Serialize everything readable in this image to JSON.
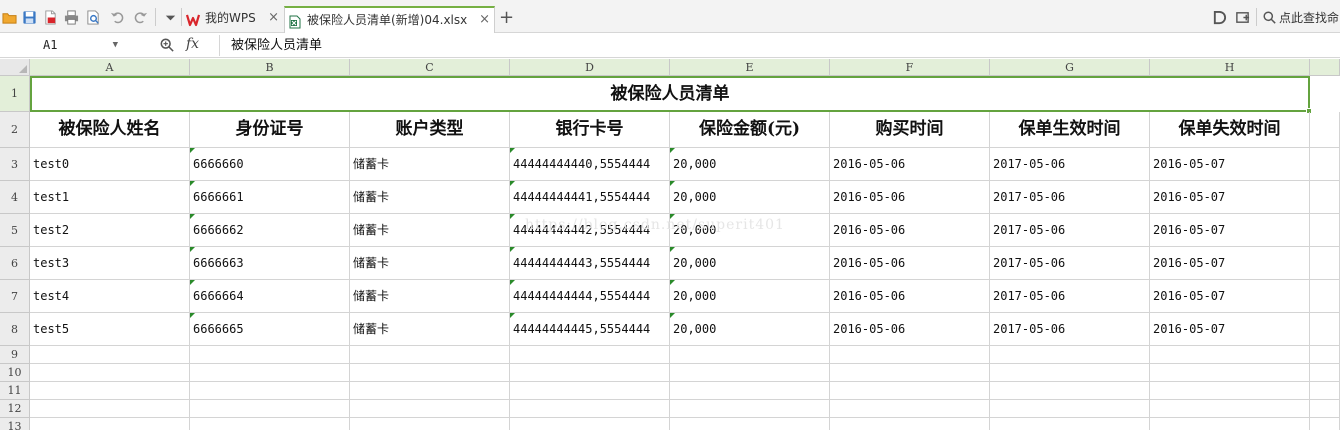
{
  "toolbar": {
    "quick_icons": [
      "open-folder-icon",
      "save-icon",
      "export-pdf-icon",
      "print-icon",
      "print-preview-icon",
      "undo-icon",
      "redo-icon",
      "dropdown-icon"
    ],
    "tabs": [
      {
        "label": "我的WPS",
        "icon": "wps-logo-icon",
        "close": "×"
      },
      {
        "label": "被保险人员清单(新增)04.xlsx",
        "icon": "excel-file-icon",
        "close": "×"
      }
    ],
    "add_tab": "+",
    "search_label": "点此查找命"
  },
  "formula_bar": {
    "name_box": "A1",
    "fx_label": "fx",
    "formula_value": "被保险人员清单"
  },
  "sheet": {
    "columns": [
      "A",
      "B",
      "C",
      "D",
      "E",
      "F",
      "G",
      "H"
    ],
    "rows": [
      "1",
      "2",
      "3",
      "4",
      "5",
      "6",
      "7",
      "8",
      "9",
      "10",
      "11",
      "12",
      "13"
    ],
    "title": "被保险人员清单",
    "headers": [
      "被保险人姓名",
      "身份证号",
      "账户类型",
      "银行卡号",
      "保险金额(元)",
      "购买时间",
      "保单生效时间",
      "保单失效时间"
    ],
    "data": [
      [
        "test0",
        "6666660",
        "储蓄卡",
        "44444444440,5554444",
        "20,000",
        "2016-05-06",
        "2017-05-06",
        "2016-05-07"
      ],
      [
        "test1",
        "6666661",
        "储蓄卡",
        "44444444441,5554444",
        "20,000",
        "2016-05-06",
        "2017-05-06",
        "2016-05-07"
      ],
      [
        "test2",
        "6666662",
        "储蓄卡",
        "44444444442,5554444",
        "20,000",
        "2016-05-06",
        "2017-05-06",
        "2016-05-07"
      ],
      [
        "test3",
        "6666663",
        "储蓄卡",
        "44444444443,5554444",
        "20,000",
        "2016-05-06",
        "2017-05-06",
        "2016-05-07"
      ],
      [
        "test4",
        "6666664",
        "储蓄卡",
        "44444444444,5554444",
        "20,000",
        "2016-05-06",
        "2017-05-06",
        "2016-05-07"
      ],
      [
        "test5",
        "6666665",
        "储蓄卡",
        "44444444445,5554444",
        "20,000",
        "2016-05-06",
        "2017-05-06",
        "2016-05-07"
      ]
    ],
    "watermark": "https://blog.csdn.net/superit401"
  },
  "colors": {
    "selection": "#64a33f",
    "header_highlight": "#e3efd9",
    "wps_red": "#d9252b",
    "excel_green": "#217346"
  }
}
